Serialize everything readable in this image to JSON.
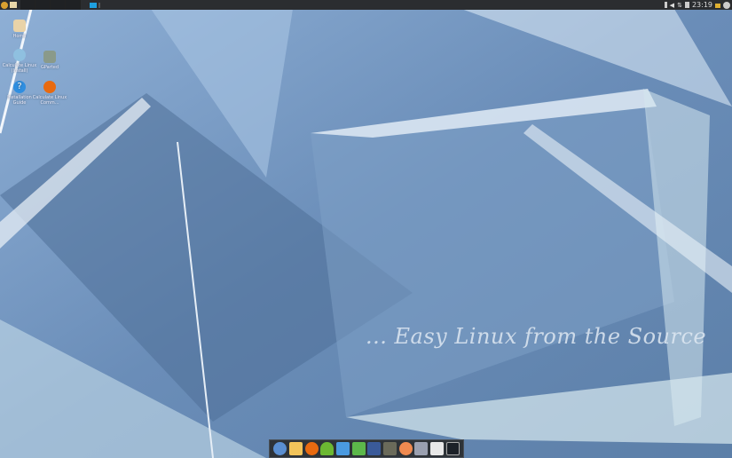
{
  "desktop_icons": [
    {
      "label": "Home",
      "icon": "folder-home-icon"
    },
    {
      "label": "Calculate Linux (Install)",
      "icon": "installer-icon"
    },
    {
      "label": "GParted",
      "icon": "gparted-icon"
    },
    {
      "label": "Installation Guide",
      "icon": "help-icon"
    },
    {
      "label": "Calculate Linux Comm...",
      "icon": "calculate-community-icon"
    }
  ],
  "tray": {
    "clock": "23:19"
  },
  "wallpaper": {
    "slogan": "... Easy Linux from the Source"
  },
  "dock": [
    "chromium-icon",
    "mail-icon",
    "calculate-icon",
    "user-icon",
    "writer-icon",
    "calc-spreadsheet-icon",
    "calculator-icon",
    "gimp-icon",
    "melon-icon",
    "video-editor-icon",
    "text-editor-icon",
    "terminal-icon"
  ]
}
